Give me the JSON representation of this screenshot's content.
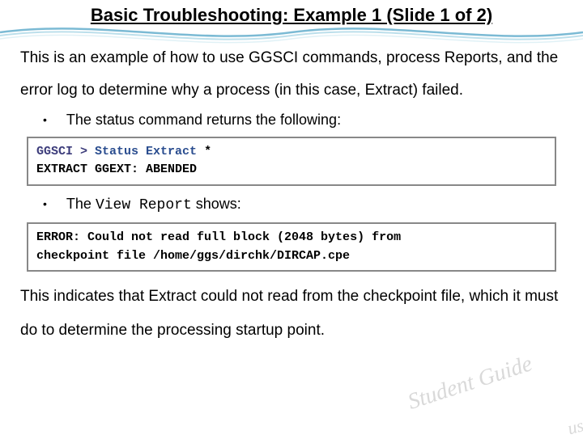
{
  "title": "Basic Troubleshooting: Example 1 (Slide 1 of 2)",
  "intro": "This is an example of how to use GGSCI commands, process Reports, and the error log to determine why a process (in this case, Extract) failed.",
  "bullet1": "The status command returns the following:",
  "code1": {
    "prompt": "GGSCI >",
    "command": "Status Extract",
    "star": "*",
    "output": "EXTRACT GGEXT: ABENDED"
  },
  "bullet2_pre": "The ",
  "bullet2_mono": "View Report",
  "bullet2_post": " shows:",
  "code2": {
    "line1": "ERROR: Could not read full block (2048 bytes) from",
    "line2": "checkpoint file /home/ggs/dirchk/DIRCAP.cpe"
  },
  "conclusion": "This indicates that Extract could not read from the checkpoint file, which it must do to determine the processing startup point.",
  "watermark1": "Student Guide",
  "watermark2": "use"
}
